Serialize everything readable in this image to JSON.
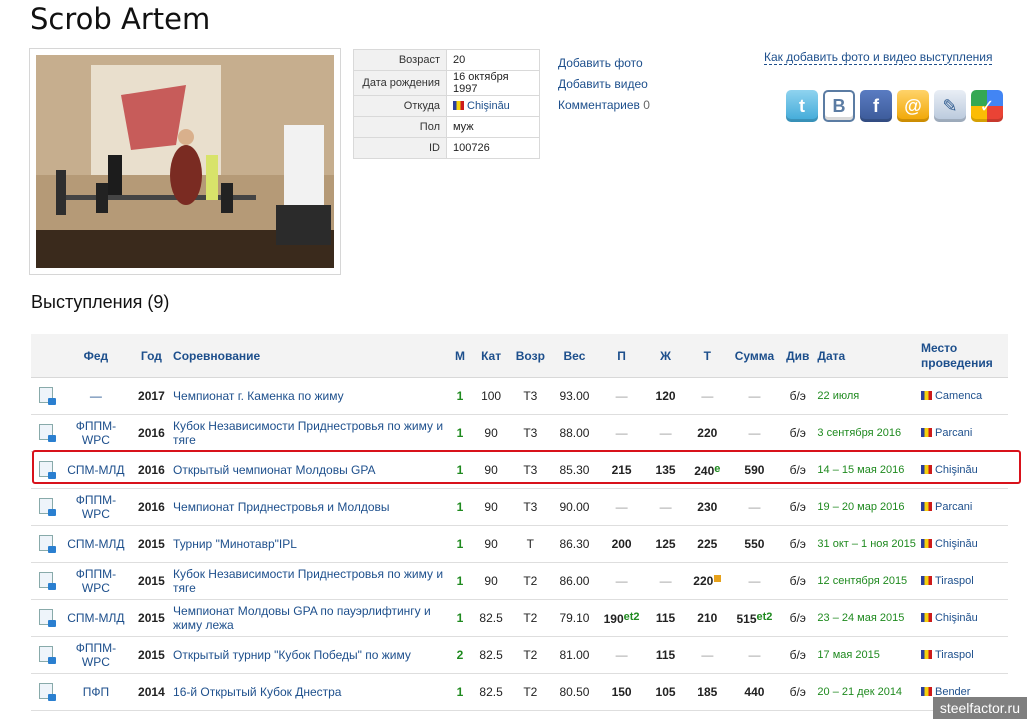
{
  "athlete": {
    "name": "Scrob Artem"
  },
  "info": [
    {
      "key": "Возраст",
      "value": "20"
    },
    {
      "key": "Дата рождения",
      "value": "16 октября 1997"
    },
    {
      "key": "Откуда",
      "value": "Chişinău"
    },
    {
      "key": "Пол",
      "value": "муж"
    },
    {
      "key": "ID",
      "value": "100726"
    }
  ],
  "links": {
    "add_photo": "Добавить фото",
    "add_video": "Добавить видео",
    "comments": "Комментариев",
    "comments_count": "0"
  },
  "howto_link": "Как добавить фото и видео выступления",
  "social": [
    "twitter-icon",
    "vk-icon",
    "facebook-icon",
    "mail-icon",
    "livejournal-icon",
    "google-icon"
  ],
  "section_title": "Выступления (9)",
  "table": {
    "headers": [
      "Фед",
      "Год",
      "Соревнование",
      "М",
      "Кат",
      "Возр",
      "Вес",
      "П",
      "Ж",
      "Т",
      "Сумма",
      "Див",
      "Дата",
      "Место проведения"
    ],
    "rows": [
      {
        "fed": "—",
        "year": "2017",
        "comp": "Чемпионат г. Каменка по жиму",
        "place": "1",
        "cat": "100",
        "age": "Т3",
        "weight": "93.00",
        "sq": "—",
        "bp": "120",
        "dl": "—",
        "total": "—",
        "div": "б/э",
        "date": "22 июля",
        "loc": "Camenca"
      },
      {
        "fed": "ФППМ-WPC",
        "year": "2016",
        "comp": "Кубок Независимости Приднестровья по жиму и тяге",
        "place": "1",
        "cat": "90",
        "age": "Т3",
        "weight": "88.00",
        "sq": "—",
        "bp": "—",
        "dl": "220",
        "total": "—",
        "div": "б/э",
        "date": "3 сентября 2016",
        "loc": "Parcani"
      },
      {
        "fed": "СПМ-МЛД",
        "year": "2016",
        "comp": "Открытый чемпионат Молдовы GPA",
        "place": "1",
        "cat": "90",
        "age": "Т3",
        "weight": "85.30",
        "sq": "215",
        "bp": "135",
        "dl": "240",
        "dl_mark": "e",
        "total": "590",
        "div": "б/э",
        "date": "14 – 15 мая 2016",
        "loc": "Chişinău"
      },
      {
        "fed": "ФППМ-WPC",
        "year": "2016",
        "comp": "Чемпионат Приднестровья и Молдовы",
        "place": "1",
        "cat": "90",
        "age": "Т3",
        "weight": "90.00",
        "sq": "—",
        "bp": "—",
        "dl": "230",
        "total": "—",
        "div": "б/э",
        "date": "19 – 20 мар 2016",
        "loc": "Parcani"
      },
      {
        "fed": "СПМ-МЛД",
        "year": "2015",
        "comp": "Турнир \"Минотавр\"IPL",
        "place": "1",
        "cat": "90",
        "age": "Т",
        "weight": "86.30",
        "sq": "200",
        "bp": "125",
        "dl": "225",
        "total": "550",
        "div": "б/э",
        "date": "31 окт – 1 ноя 2015",
        "loc": "Chişinău"
      },
      {
        "fed": "ФППМ-WPC",
        "year": "2015",
        "comp": "Кубок Независимости Приднестровья по жиму и тяге",
        "place": "1",
        "cat": "90",
        "age": "Т2",
        "weight": "86.00",
        "sq": "—",
        "bp": "—",
        "dl": "220",
        "total": "—",
        "div": "б/э",
        "date": "12 сентября 2015",
        "loc": "Tiraspol"
      },
      {
        "fed": "СПМ-МЛД",
        "year": "2015",
        "comp": "Чемпионат Молдовы GPA по пауэрлифтингу и жиму лежа",
        "place": "1",
        "cat": "82.5",
        "age": "Т2",
        "weight": "79.10",
        "sq": "190",
        "sq_mark": "et2",
        "bp": "115",
        "dl": "210",
        "total": "515",
        "total_mark": "et2",
        "div": "б/э",
        "date": "23 – 24 мая 2015",
        "loc": "Chişinău"
      },
      {
        "fed": "ФППМ-WPC",
        "year": "2015",
        "comp": "Открытый турнир \"Кубок Победы\" по жиму",
        "place": "2",
        "cat": "82.5",
        "age": "Т2",
        "weight": "81.00",
        "sq": "—",
        "bp": "115",
        "dl": "—",
        "total": "—",
        "div": "б/э",
        "date": "17 мая 2015",
        "loc": "Tiraspol"
      },
      {
        "fed": "ПФП",
        "year": "2014",
        "comp": "16-й Открытый Кубок Днестра",
        "place": "1",
        "cat": "82.5",
        "age": "Т2",
        "weight": "80.50",
        "sq": "150",
        "bp": "105",
        "dl": "185",
        "total": "440",
        "div": "б/э",
        "date": "20 – 21 дек 2014",
        "loc": "Bender"
      }
    ]
  },
  "watermark": "steelfactor.ru",
  "colors": {
    "link": "#1d4f8c",
    "green": "#1f8a1f",
    "highlight": "#d8121b"
  }
}
